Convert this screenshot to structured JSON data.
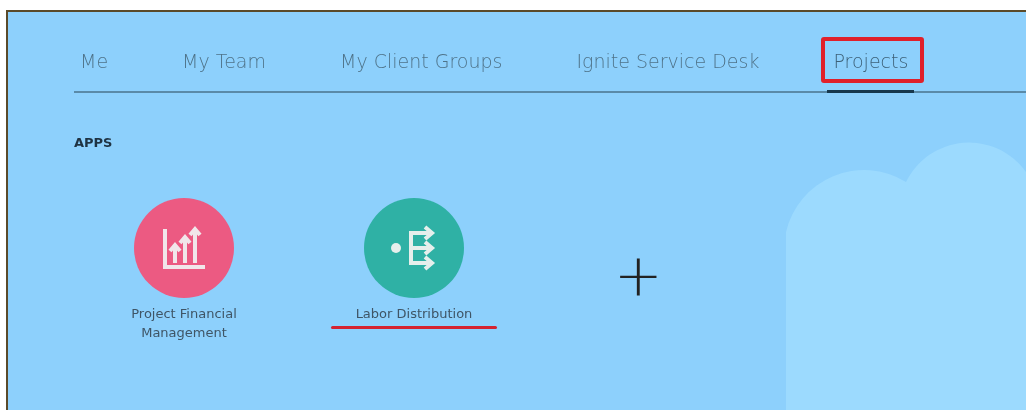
{
  "tabs": [
    {
      "label": "Me",
      "selected": false,
      "highlighted": false
    },
    {
      "label": "My Team",
      "selected": false,
      "highlighted": false
    },
    {
      "label": "My Client Groups",
      "selected": false,
      "highlighted": false
    },
    {
      "label": "Ignite Service Desk",
      "selected": false,
      "highlighted": false
    },
    {
      "label": "Projects",
      "selected": true,
      "highlighted": true
    }
  ],
  "section_title": "APPS",
  "apps": [
    {
      "label": "Project Financial Management",
      "kind": "chart",
      "color": "#ec5a82",
      "highlighted": false
    },
    {
      "label": "Labor Distribution",
      "kind": "distribution",
      "color": "#2fb1a5",
      "highlighted": true
    }
  ],
  "add_tile": "+"
}
